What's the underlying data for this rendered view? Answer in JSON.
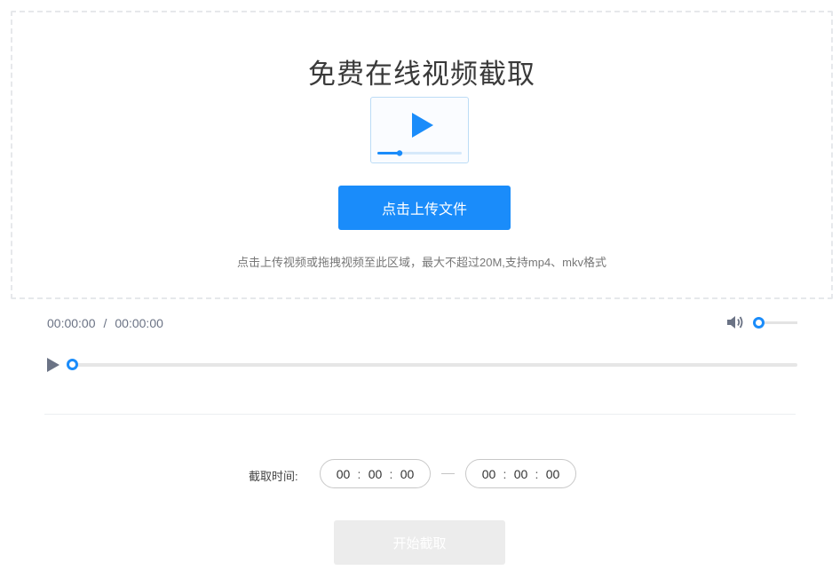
{
  "upload": {
    "title": "免费在线视频截取",
    "button_label": "点击上传文件",
    "hint": "点击上传视频或拖拽视频至此区域，最大不超过20M,支持mp4、mkv格式",
    "thumbnail_icon": "video-player-icon"
  },
  "player": {
    "current_time": "00:00:00",
    "separator": "/",
    "duration": "00:00:00",
    "progress": 0,
    "volume": 0,
    "play_icon": "play-icon",
    "volume_icon": "speaker-icon"
  },
  "clip": {
    "label": "截取时间:",
    "start": {
      "h": "00",
      "m": "00",
      "s": "00"
    },
    "end": {
      "h": "00",
      "m": "00",
      "s": "00"
    },
    "colon": ":",
    "start_button_label": "开始截取"
  },
  "colors": {
    "accent": "#1a8cfa",
    "disabled_button": "#ececec"
  }
}
